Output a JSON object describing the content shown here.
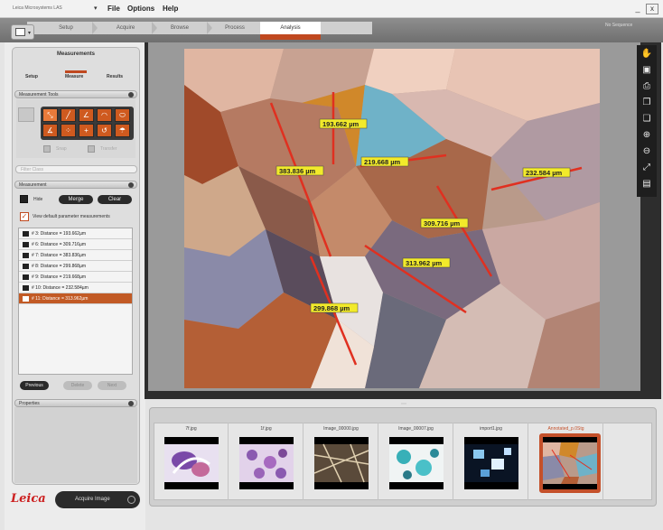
{
  "window": {
    "app_title": "Leica Microsystems LAS",
    "app_dropdown": "▾",
    "menus": [
      "File",
      "Options",
      "Help"
    ],
    "min_label": "_",
    "close_label": "x"
  },
  "workflow_tabs": [
    "Setup",
    "Acquire",
    "Browse",
    "Process",
    "Analysis"
  ],
  "active_workflow_tab": "Analysis",
  "sequence_label": "No Sequence",
  "mode_button_arrow": "▾",
  "measurements_panel": {
    "title": "Measurements",
    "tabs": [
      "Setup",
      "Measure",
      "Results"
    ],
    "tools_group_title": "Measurement Tools",
    "tool_glyphs": [
      "⤡",
      "╱",
      "∠",
      "◠",
      "⬭",
      "∡",
      "⁘",
      "+",
      "↺",
      "☂"
    ],
    "option_labels": [
      "Snap",
      "Transfer"
    ],
    "filter_placeholder": "Filter Class",
    "measurement_group_title": "Measurement",
    "hide_label": "Hide",
    "merge_button": "Merge",
    "clear_button": "Clear",
    "view_default_label": "View default parameter measurements",
    "checkmark": "✓",
    "list_items": [
      "# 3: Distance = 193.662µm",
      "# 6: Distance = 309.716µm",
      "# 7: Distance = 383.836µm",
      "# 8: Distance = 299.868µm",
      "# 9: Distance = 219.668µm",
      "# 10: Distance = 232.584µm",
      "# 11: Distance = 313.962µm"
    ],
    "selected_index": 6,
    "previous_button": "Previous",
    "delete_button": "Delete",
    "next_button": "Next",
    "properties_group_title": "Properties"
  },
  "logo_text": "Leica",
  "acquire_button": "Acquire Image",
  "viewer": {
    "measurements": [
      {
        "label": "193.662 µm",
        "color": "#e03020"
      },
      {
        "label": "219.668 µm",
        "color": "#e03020"
      },
      {
        "label": "383.836 µm",
        "color": "#e03020"
      },
      {
        "label": "232.584 µm",
        "color": "#e03020"
      },
      {
        "label": "309.716 µm",
        "color": "#e03020"
      },
      {
        "label": "313.962 µm",
        "color": "#e03020"
      },
      {
        "label": "299.868 µm",
        "color": "#e03020"
      }
    ],
    "label_bg": "#f2ea2a",
    "right_tool_icons": [
      "hand-icon",
      "save-icon",
      "print-icon",
      "copy-icon",
      "paste-icon",
      "zoom-in-icon",
      "zoom-out-icon",
      "fit-icon",
      "overlay-icon"
    ],
    "right_tool_glyphs": [
      "✋",
      "▣",
      "⎙",
      "❐",
      "❏",
      "⊕",
      "⊖",
      "⤢",
      "▤"
    ],
    "splitter_grip": "⋯"
  },
  "gallery": {
    "items": [
      {
        "name": "7f.jpg"
      },
      {
        "name": "1f.jpg"
      },
      {
        "name": "Image_00000.jpg"
      },
      {
        "name": "Image_00007.jpg"
      },
      {
        "name": "import1.jpg"
      },
      {
        "name": "Annotated_p.0Stg"
      }
    ],
    "selected_index": 5,
    "accent": "#c4502a"
  }
}
